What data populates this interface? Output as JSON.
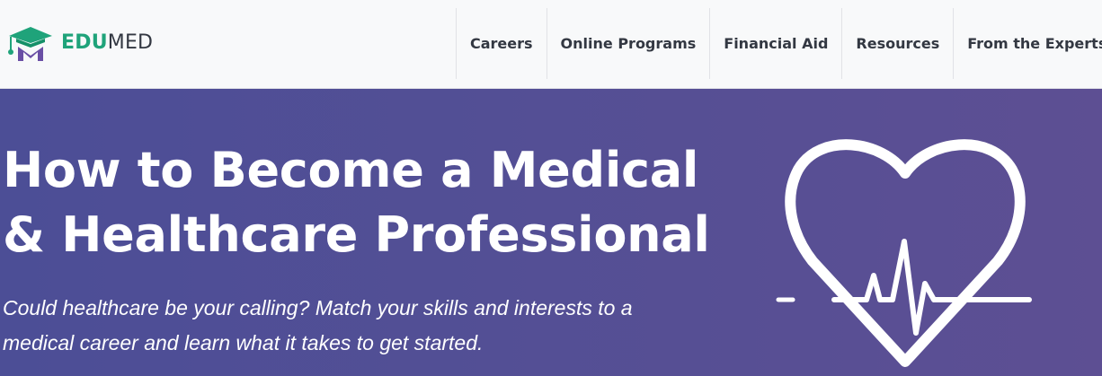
{
  "brand": {
    "name_part1": "EDU",
    "name_part2": "MED",
    "logo_icon": "graduation-cap-med-logo",
    "colors": {
      "green": "#1fa37a",
      "purple": "#6a4fa5",
      "text": "#333842"
    }
  },
  "nav": {
    "items": [
      {
        "label": "Careers"
      },
      {
        "label": "Online Programs"
      },
      {
        "label": "Financial Aid"
      },
      {
        "label": "Resources"
      },
      {
        "label": "From the Experts"
      }
    ]
  },
  "hero": {
    "title_line1": "How to Become a Medical",
    "title_line2": "& Healthcare Professional",
    "subtitle_line1": "Could healthcare be your calling? Match your skills and interests to a",
    "subtitle_line2": "medical career and learn what it takes to get started.",
    "icon": "heart-pulse-icon",
    "colors": {
      "gradient_start": "#4c4e96",
      "gradient_end": "#5d4f93",
      "text": "#ffffff"
    }
  }
}
